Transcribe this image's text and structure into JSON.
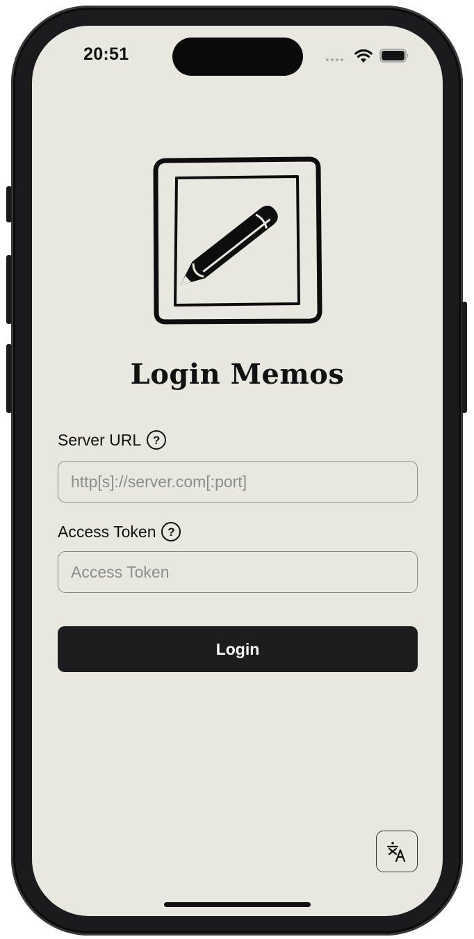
{
  "status_bar": {
    "time": "20:51"
  },
  "login": {
    "title": "Login Memos",
    "server_url": {
      "label": "Server URL",
      "placeholder": "http[s]://server.com[:port]",
      "value": ""
    },
    "access_token": {
      "label": "Access Token",
      "placeholder": "Access Token",
      "value": ""
    },
    "submit_label": "Login"
  },
  "icons": {
    "logo": "pencil-in-square-icon",
    "help": "question-circle-icon",
    "language": "translate-icon"
  },
  "colors": {
    "background": "#e9e8e0",
    "button": "#1d1d1f",
    "button_text": "#ffffff",
    "placeholder": "#8c8c8c"
  }
}
